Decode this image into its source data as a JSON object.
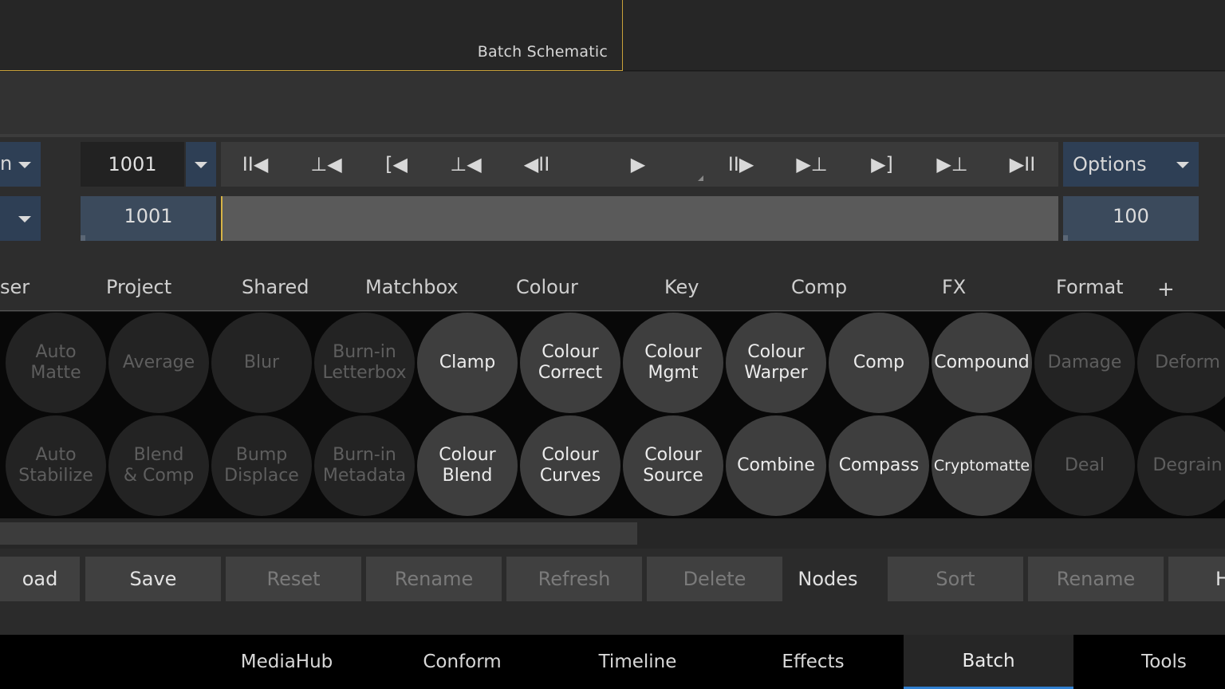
{
  "viewport": {
    "schematic_label": "Batch Schematic"
  },
  "transport": {
    "left_dropdown_text": "n",
    "current_frame": "1001",
    "buttons": [
      {
        "name": "go-to-start",
        "glyph": "II◀"
      },
      {
        "name": "prev-keyframe",
        "glyph": "⊥◀"
      },
      {
        "name": "go-to-in",
        "glyph": "[◀"
      },
      {
        "name": "prev-event",
        "glyph": "⊥◀"
      },
      {
        "name": "step-back",
        "glyph": "◀II"
      },
      {
        "name": "play",
        "glyph": "▶"
      },
      {
        "name": "step-forward",
        "glyph": "II▶"
      },
      {
        "name": "next-event",
        "glyph": "▶⊥"
      },
      {
        "name": "go-to-out",
        "glyph": "▶]"
      },
      {
        "name": "next-keyframe",
        "glyph": "▶⊥"
      },
      {
        "name": "go-to-end",
        "glyph": "▶II"
      }
    ],
    "options_label": "Options",
    "in_frame": "1001",
    "out_frame": "100"
  },
  "categories": {
    "tabs": [
      "ser",
      "Project",
      "Shared",
      "Matchbox",
      "Colour",
      "Key",
      "Comp",
      "FX",
      "Format"
    ],
    "add_label": "+"
  },
  "nodes": {
    "row1": [
      {
        "label": "Auto\nMatte",
        "enabled": false
      },
      {
        "label": "Average",
        "enabled": false
      },
      {
        "label": "Blur",
        "enabled": false
      },
      {
        "label": "Burn-in\nLetterbox",
        "enabled": false
      },
      {
        "label": "Clamp",
        "enabled": true
      },
      {
        "label": "Colour\nCorrect",
        "enabled": true
      },
      {
        "label": "Colour\nMgmt",
        "enabled": true
      },
      {
        "label": "Colour\nWarper",
        "enabled": true
      },
      {
        "label": "Comp",
        "enabled": true
      },
      {
        "label": "Compound",
        "enabled": true
      },
      {
        "label": "Damage",
        "enabled": false
      },
      {
        "label": "Deform",
        "enabled": false
      }
    ],
    "row2": [
      {
        "label": "Auto\nStabilize",
        "enabled": false
      },
      {
        "label": "Blend\n& Comp",
        "enabled": false
      },
      {
        "label": "Bump\nDisplace",
        "enabled": false
      },
      {
        "label": "Burn-in\nMetadata",
        "enabled": false
      },
      {
        "label": "Colour\nBlend",
        "enabled": true
      },
      {
        "label": "Colour\nCurves",
        "enabled": true
      },
      {
        "label": "Colour\nSource",
        "enabled": true
      },
      {
        "label": "Combine",
        "enabled": true
      },
      {
        "label": "Compass",
        "enabled": true
      },
      {
        "label": "Cryptomatte",
        "enabled": true
      },
      {
        "label": "Deal",
        "enabled": false
      },
      {
        "label": "Degrain",
        "enabled": false
      }
    ]
  },
  "bin_buttons": {
    "load": "oad",
    "save": "Save",
    "reset": "Reset",
    "rename": "Rename",
    "refresh": "Refresh",
    "delete": "Delete",
    "nodes_label": "Nodes",
    "sort": "Sort",
    "rename2": "Rename",
    "h": "H"
  },
  "main_tabs": [
    {
      "label": "MediaHub",
      "active": false
    },
    {
      "label": "Conform",
      "active": false
    },
    {
      "label": "Timeline",
      "active": false
    },
    {
      "label": "Effects",
      "active": false
    },
    {
      "label": "Batch",
      "active": true
    },
    {
      "label": "Tools",
      "active": false
    }
  ],
  "colors": {
    "accent": "#2f7fd0",
    "playhead": "#d7b446",
    "panel_border": "#c9a23a"
  }
}
